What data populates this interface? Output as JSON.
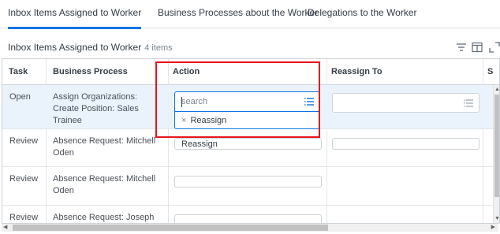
{
  "tabs": [
    {
      "label": "Inbox Items Assigned to Worker",
      "active": true
    },
    {
      "label": "Business Processes about the Worker",
      "active": false
    },
    {
      "label": "Delegations to the Worker",
      "active": false
    }
  ],
  "table": {
    "title": "Inbox Items Assigned to Worker",
    "count": "4 items",
    "columns": [
      "Task",
      "Business Process",
      "Action",
      "Reassign To",
      "S"
    ],
    "rows": [
      {
        "task": "Open",
        "process": "Assign Organizations: Create Position: Sales Trainee",
        "action": "",
        "reassign_to": ""
      },
      {
        "task": "Review",
        "process": "Absence Request: Mitchell Oden",
        "action": "Reassign",
        "reassign_to": ""
      },
      {
        "task": "Review",
        "process": "Absence Request: Mitchell Oden",
        "action": "",
        "reassign_to": ""
      },
      {
        "task": "Review",
        "process": "Absence Request: Joseph",
        "action": "",
        "reassign_to": ""
      }
    ]
  },
  "action_dropdown": {
    "placeholder": "search",
    "selected_chip": "Reassign",
    "chip_remove_glyph": "×"
  },
  "icons": {
    "filter": "filter-icon",
    "columns": "columns-icon",
    "expand": "expand-icon",
    "list": "list-icon"
  },
  "colors": {
    "accent": "#0875e1",
    "highlight": "#e8121c",
    "selected_row": "#eaf3fc"
  }
}
